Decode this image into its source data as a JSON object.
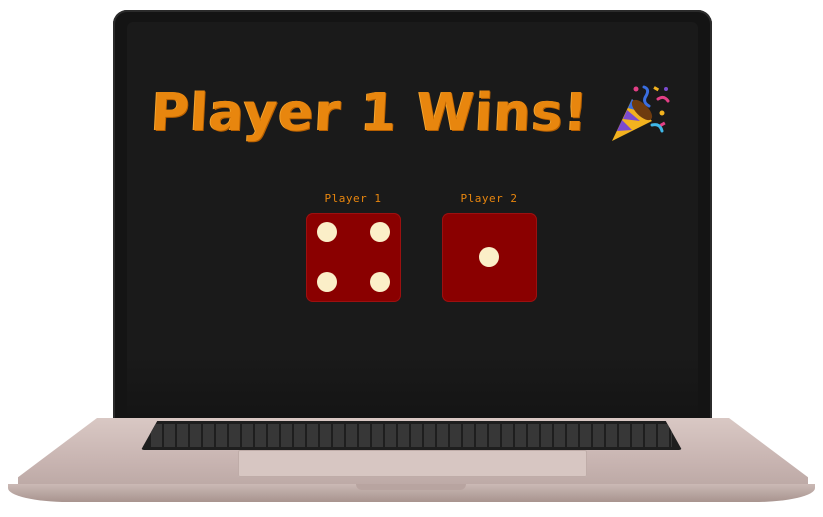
{
  "game": {
    "title": "Player 1 Wins!",
    "title_icon": "party-popper-icon",
    "accent_color": "#e8860e",
    "die_color": "#8a0000",
    "pip_color": "#fbefc8"
  },
  "players": [
    {
      "label": "Player 1",
      "die_value": 4
    },
    {
      "label": "Player 2",
      "die_value": 1
    }
  ]
}
